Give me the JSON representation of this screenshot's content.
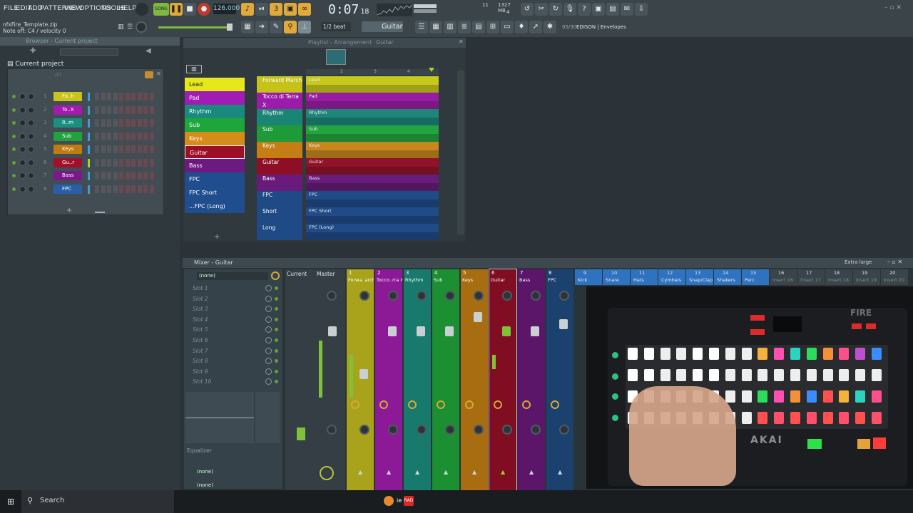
{
  "menu": [
    "FILE",
    "EDIT",
    "ADD",
    "PATTERNS",
    "VIEW",
    "OPTIONS",
    "TOOLS",
    "HELP"
  ],
  "toolbar": {
    "song_label": "SONG",
    "tempo": "126.000",
    "clock": "0:07",
    "clock_ticks": "18",
    "cpu_value": "11",
    "memory": "1327 MB",
    "voices": "4",
    "snap_label": "1/2 beat",
    "channel_select": "Guitar",
    "hint_title": "EDISON | Envelopes",
    "hint_counter": "05/30"
  },
  "hints": {
    "filename": "nfxFire_Template.zip",
    "note": "Note off: C4 / velocity 0"
  },
  "browser": {
    "title": "Browser - Current project",
    "current_project": "Current project",
    "filter_all": "All"
  },
  "channel_rack": {
    "channels": [
      {
        "num": "1",
        "name": "Fo..h",
        "color": "#c9c31a"
      },
      {
        "num": "2",
        "name": "To..X",
        "color": "#a51bb0"
      },
      {
        "num": "3",
        "name": "R..m",
        "color": "#1b8f80"
      },
      {
        "num": "4",
        "name": "Sub",
        "color": "#22a23c"
      },
      {
        "num": "5",
        "name": "Keys",
        "color": "#c07c10"
      },
      {
        "num": "6",
        "name": "Gu..r",
        "color": "#a0102a"
      },
      {
        "num": "7",
        "name": "Bass",
        "color": "#7a1a8a"
      },
      {
        "num": "8",
        "name": "FPC",
        "color": "#2b5ea8"
      }
    ]
  },
  "playlist": {
    "title": "Playlist - Arrangement",
    "pattern": "Guitar",
    "patterns": [
      {
        "name": "Lead",
        "color": "#e6e81a",
        "text": "#222"
      },
      {
        "name": "Pad",
        "color": "#a11bb6",
        "text": "#fff"
      },
      {
        "name": "Rhythm",
        "color": "#1a8a7e",
        "text": "#fff"
      },
      {
        "name": "Sub",
        "color": "#1fa63a",
        "text": "#fff"
      },
      {
        "name": "Keys",
        "color": "#d68c1a",
        "text": "#fff"
      },
      {
        "name": "Guitar",
        "color": "#9b0f27",
        "text": "#fff"
      },
      {
        "name": "Bass",
        "color": "#6d1a80",
        "text": "#fff"
      },
      {
        "name": "FPC",
        "color": "#1f4d8e",
        "text": "#fff"
      },
      {
        "name": "FPC Short",
        "color": "#1f4d8e",
        "text": "#fff"
      },
      {
        "name": "...FPC (Long)",
        "color": "#1f4d8e",
        "text": "#fff"
      }
    ],
    "tracks": [
      {
        "name": "Forward March",
        "color": "#c5c21a",
        "clip": "Lead",
        "clipcolor": "#d9d91a"
      },
      {
        "name": "Tocco di Terra X",
        "color": "#9b1ca8",
        "clip": "Pad",
        "clipcolor": "#a51bb0"
      },
      {
        "name": "Rhythm",
        "color": "#1b8575",
        "clip": "Rhythm",
        "clipcolor": "#1b8f80"
      },
      {
        "name": "Sub",
        "color": "#1f9a39",
        "clip": "Sub",
        "clipcolor": "#22b040"
      },
      {
        "name": "Keys",
        "color": "#c47e13",
        "clip": "Keys",
        "clipcolor": "#d8901a"
      },
      {
        "name": "Guitar",
        "color": "#8e0f25",
        "clip": "Guitar",
        "clipcolor": "#9b0f27"
      },
      {
        "name": "Bass",
        "color": "#6a1a7a",
        "clip": "Bass",
        "clipcolor": "#6d1a80"
      },
      {
        "name": "FPC",
        "color": "#1f4a85",
        "clip": "FPC",
        "clipcolor": "#1f4d8e"
      },
      {
        "name": "Short",
        "color": "#1f4a85",
        "clip": "FPC Short",
        "clipcolor": "#1f4d8e"
      },
      {
        "name": "Long",
        "color": "#1f4a85",
        "clip": "FPC (Long)",
        "clipcolor": "#1f4d8e"
      }
    ],
    "bars": [
      "2",
      "3",
      "4"
    ]
  },
  "mixer": {
    "title": "Mixer - Guitar",
    "preset": "(none)",
    "slots": [
      "Slot 1",
      "Slot 2",
      "Slot 3",
      "Slot 4",
      "Slot 5",
      "Slot 6",
      "Slot 7",
      "Slot 8",
      "Slot 9",
      "Slot 10"
    ],
    "equalizer": "Equalizer",
    "bottom1": "(none)",
    "bottom2": "(none)",
    "current": "Current",
    "master": "Master",
    "view_mode": "Extra large",
    "strips": [
      {
        "num": "1",
        "name": "Forwa..arch",
        "color": "#a9a21b"
      },
      {
        "num": "2",
        "name": "Tocco..rra X",
        "color": "#8c1a96"
      },
      {
        "num": "3",
        "name": "Rhythm",
        "color": "#177a6c"
      },
      {
        "num": "4",
        "name": "Sub",
        "color": "#1c8f33"
      },
      {
        "num": "5",
        "name": "Keys",
        "color": "#a86d11"
      },
      {
        "num": "6",
        "name": "Guitar",
        "color": "#800d22"
      },
      {
        "num": "7",
        "name": "Bass",
        "color": "#5c1669"
      },
      {
        "num": "8",
        "name": "FPC",
        "color": "#1b416f"
      }
    ],
    "inserts": [
      {
        "num": "9",
        "name": "Kick"
      },
      {
        "num": "10",
        "name": "Snare"
      },
      {
        "num": "11",
        "name": "Hats"
      },
      {
        "num": "12",
        "name": "Cymbals"
      },
      {
        "num": "13",
        "name": "Snap/Clap"
      },
      {
        "num": "14",
        "name": "Shakers"
      },
      {
        "num": "15",
        "name": "Perc"
      },
      {
        "num": "16",
        "name": "Insert 16"
      },
      {
        "num": "17",
        "name": "Insert 17"
      },
      {
        "num": "18",
        "name": "Insert 18"
      },
      {
        "num": "19",
        "name": "Insert 19"
      },
      {
        "num": "20",
        "name": "Insert 20"
      }
    ]
  },
  "video": {
    "brand": "AKAI",
    "device": "FIRE"
  },
  "taskbar": {
    "search": "Search",
    "app_badge": "RAD"
  }
}
